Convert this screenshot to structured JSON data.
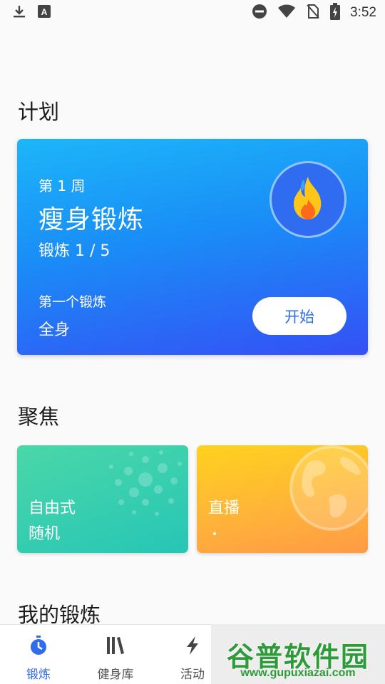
{
  "status_bar": {
    "time": "3:52",
    "left_icons": [
      "download-icon",
      "text-a-icon"
    ],
    "right_icons": [
      "do-not-disturb-icon",
      "wifi-icon",
      "no-sim-icon",
      "battery-charging-icon"
    ]
  },
  "sections": {
    "plan_title": "计划",
    "focus_title": "聚焦",
    "my_workouts_title": "我的锻炼"
  },
  "plan_card": {
    "week": "第 1 周",
    "name": "瘦身锻炼",
    "progress": "锻炼 1 / 5",
    "first_label": "第一个锻炼",
    "first_value": "全身",
    "start_label": "开始",
    "badge_icon": "flame-icon",
    "colors": {
      "gradient_top": "#1cb6f8",
      "gradient_bottom": "#3550f5"
    }
  },
  "focus_cards": [
    {
      "line1": "自由式",
      "line2": "随机",
      "color": "#2cc9b3"
    },
    {
      "line1": "直播",
      "line2": ".",
      "color": "#ffb23a"
    }
  ],
  "bottom_nav": [
    {
      "label": "锻炼",
      "icon": "stopwatch-icon",
      "active": true
    },
    {
      "label": "健身库",
      "icon": "library-icon",
      "active": false
    },
    {
      "label": "活动",
      "icon": "lightning-icon",
      "active": false
    }
  ],
  "watermark": {
    "brand": "谷普软件园",
    "url": "www.gupuxiazai.com"
  },
  "accent_color": "#2f6cf0"
}
